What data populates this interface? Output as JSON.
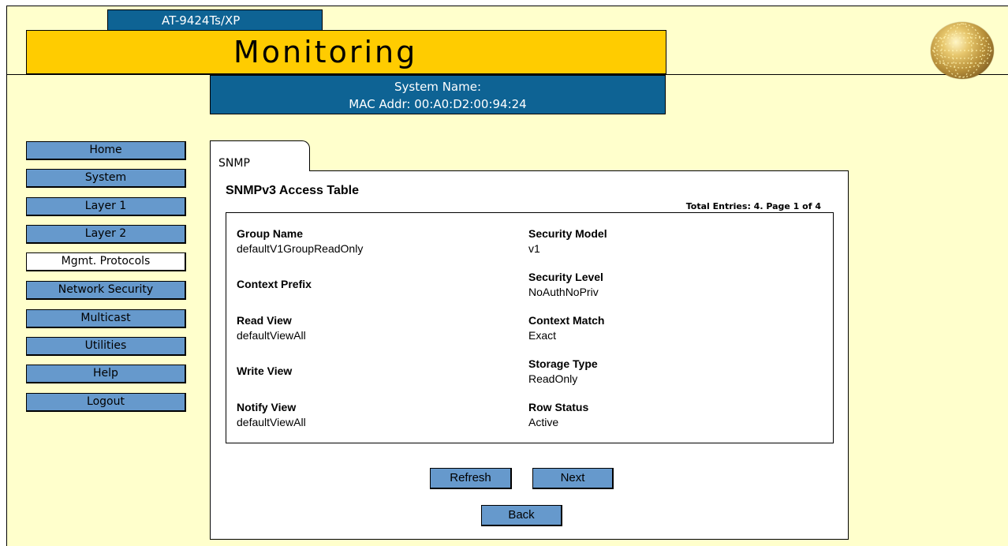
{
  "header": {
    "model": "AT-9424Ts/XP",
    "section_title": "Monitoring",
    "system_name_label": "System Name:",
    "mac_label": "MAC Addr: 00:A0:D2:00:94:24"
  },
  "nav": {
    "items": [
      {
        "label": "Home"
      },
      {
        "label": "System"
      },
      {
        "label": "Layer 1"
      },
      {
        "label": "Layer 2"
      },
      {
        "label": "Mgmt. Protocols",
        "active": true
      },
      {
        "label": "Network Security"
      },
      {
        "label": "Multicast"
      },
      {
        "label": "Utilities"
      },
      {
        "label": "Help"
      },
      {
        "label": "Logout"
      }
    ]
  },
  "tab": {
    "label": "SNMP"
  },
  "table": {
    "title": "SNMPv3 Access Table",
    "total": "Total Entries: 4. Page 1 of 4",
    "left": [
      {
        "label": "Group Name",
        "value": "defaultV1GroupReadOnly"
      },
      {
        "label": "Context Prefix",
        "value": ""
      },
      {
        "label": "Read View",
        "value": "defaultViewAll"
      },
      {
        "label": "Write View",
        "value": ""
      },
      {
        "label": "Notify View",
        "value": "defaultViewAll"
      }
    ],
    "right": [
      {
        "label": "Security Model",
        "value": "v1"
      },
      {
        "label": "Security Level",
        "value": "NoAuthNoPriv"
      },
      {
        "label": "Context Match",
        "value": "Exact"
      },
      {
        "label": "Storage Type",
        "value": "ReadOnly"
      },
      {
        "label": "Row Status",
        "value": "Active"
      }
    ]
  },
  "buttons": {
    "refresh": "Refresh",
    "next": "Next",
    "back": "Back"
  },
  "colors": {
    "background": "#ffffcc",
    "banner_yellow": "#ffcc00",
    "banner_blue": "#0e6394",
    "button_blue": "#6699cc"
  },
  "icons": {
    "logo": "globe-logo-icon"
  }
}
